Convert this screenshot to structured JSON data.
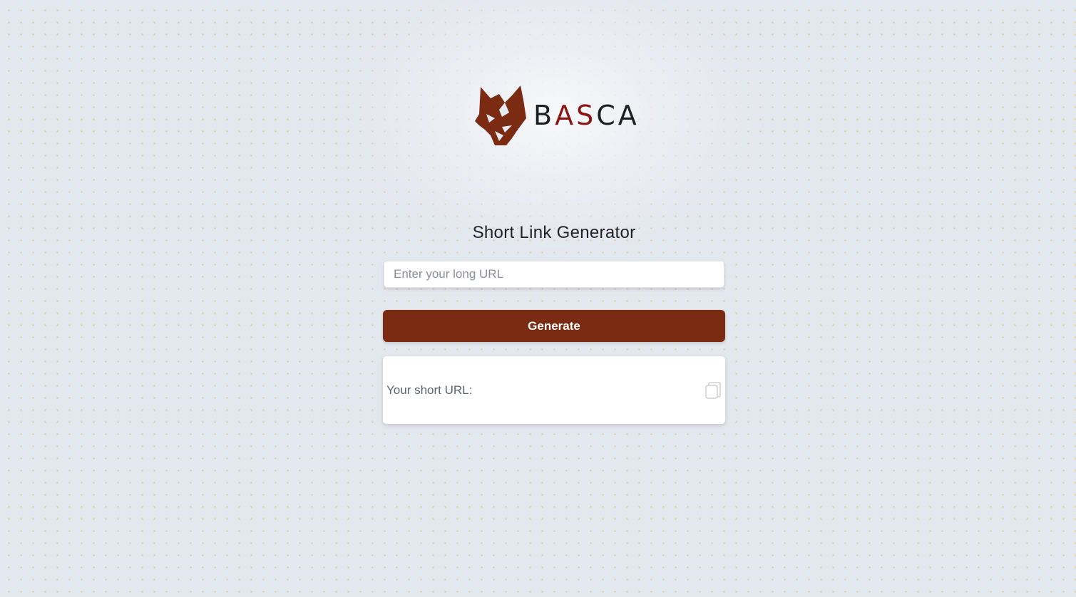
{
  "brand": {
    "logo_prefix": "B",
    "logo_accent": "AS",
    "logo_suffix": "CA",
    "logo_icon": "wolf-head-icon",
    "accent_color": "#8b1414",
    "mark_color": "#7b2b12"
  },
  "main": {
    "title": "Short Link Generator",
    "url_input": {
      "placeholder": "Enter your long URL",
      "value": ""
    },
    "generate_label": "Generate",
    "result": {
      "label": "Your short URL:",
      "value": "",
      "copy_icon": "copy-icon"
    }
  },
  "colors": {
    "button": "#7b2b12",
    "background": "#e3e7ee",
    "dot": "#e6aa46"
  }
}
